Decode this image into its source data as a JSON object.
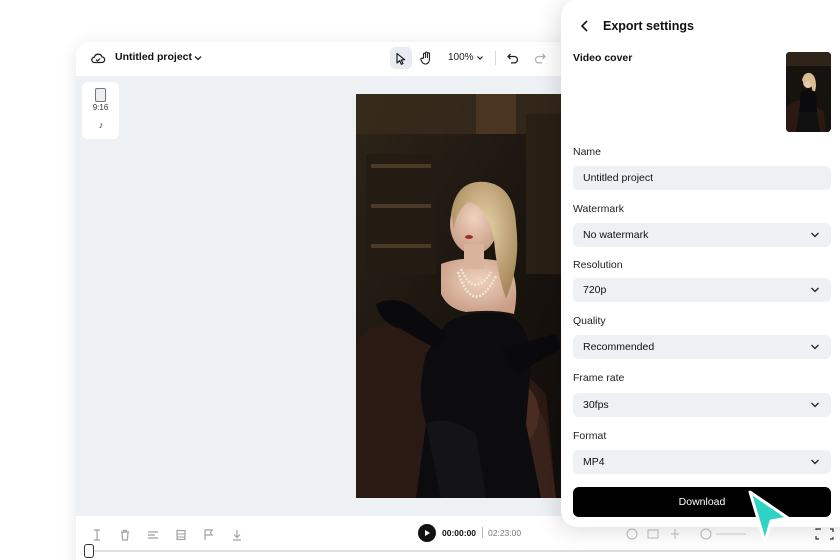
{
  "editor": {
    "project_title": "Untitled project",
    "zoom": "100%",
    "aspect_ratio": "9:16",
    "time_current": "00:00:00",
    "time_total": "02:23:00"
  },
  "export": {
    "title": "Export settings",
    "video_cover_label": "Video cover",
    "name_label": "Name",
    "name_value": "Untitled project",
    "watermark_label": "Watermark",
    "watermark_value": "No watermark",
    "resolution_label": "Resolution",
    "resolution_value": "720p",
    "quality_label": "Quality",
    "quality_value": "Recommended",
    "framerate_label": "Frame rate",
    "framerate_value": "30fps",
    "format_label": "Format",
    "format_value": "MP4",
    "download_label": "Download"
  },
  "colors": {
    "accent_cursor": "#2fd3c4",
    "download_bg": "#000000",
    "field_bg": "#eef1f4",
    "canvas_bg": "#eef1f4"
  },
  "icons": [
    "cloud-icon",
    "chevron-down-icon",
    "pointer-icon",
    "hand-icon",
    "undo-icon",
    "redo-icon",
    "tiktok-icon",
    "play-icon",
    "back-icon",
    "cursor-icon"
  ]
}
